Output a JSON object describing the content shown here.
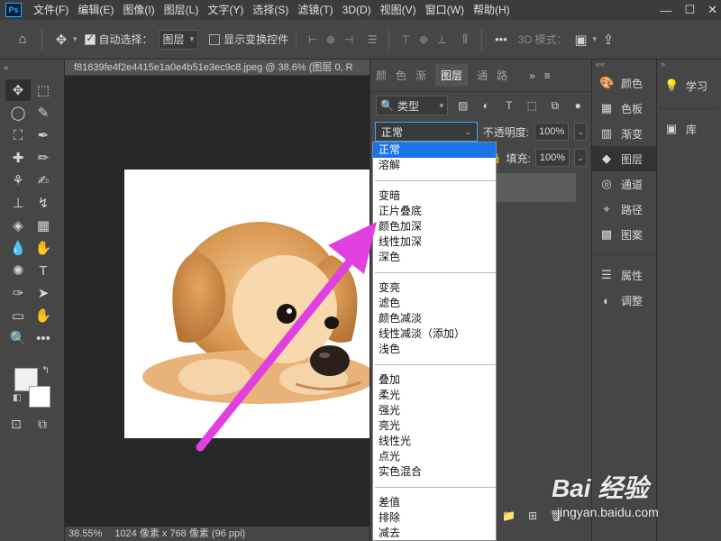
{
  "app": {
    "logo": "Ps",
    "menu": [
      "文件(F)",
      "编辑(E)",
      "图像(I)",
      "图层(L)",
      "文字(Y)",
      "选择(S)",
      "滤镜(T)",
      "3D(D)",
      "视图(V)",
      "窗口(W)",
      "帮助(H)"
    ],
    "window_controls": [
      "—",
      "☐",
      "✕"
    ]
  },
  "options_bar": {
    "auto_select_label": "自动选择：",
    "auto_select_target": "图层",
    "transform_controls_label": "显示变换控件",
    "more": "•••",
    "mode_3d_label": "3D 模式："
  },
  "toolbar": {
    "collapse": "«",
    "tools": [
      [
        "move-tool",
        "marquee-tool"
      ],
      [
        "lasso-tool",
        "quick-select-tool"
      ],
      [
        "crop-tool",
        "eyedropper-tool"
      ],
      [
        "healing-brush-tool",
        "brush-tool"
      ],
      [
        "clone-stamp-tool",
        "history-brush-tool"
      ],
      [
        "stamp-tool",
        "smudge-tool"
      ],
      [
        "eraser-tool",
        "gradient-tool"
      ],
      [
        "blur-tool",
        "dodge-tool"
      ],
      [
        "sponge-tool",
        "type-tool"
      ],
      [
        "pen-tool",
        "path-select-tool"
      ],
      [
        "shape-tool",
        "hand-tool"
      ],
      [
        "zoom-tool",
        "more-tools"
      ]
    ],
    "tool_glyphs": [
      [
        "✥",
        "⬚"
      ],
      [
        "◯",
        "✎"
      ],
      [
        "⛶",
        "✒"
      ],
      [
        "✚",
        "✏"
      ],
      [
        "⚘",
        "✍"
      ],
      [
        "⊥",
        "↯"
      ],
      [
        "◈",
        "▦"
      ],
      [
        "💧",
        "✋"
      ],
      [
        "✺",
        "T"
      ],
      [
        "✑",
        "➤"
      ],
      [
        "▭",
        "✋"
      ],
      [
        "🔍",
        "•••"
      ]
    ]
  },
  "document": {
    "tab_title": "f81639fe4f2e4415e1a0e4b51e3ec9c8.jpeg @ 38.6% (图层 0, R",
    "zoom": "38.55%",
    "dimensions": "1024 像素 x 768 像素 (96 ppi)"
  },
  "layers_panel": {
    "tabs": [
      "颜",
      "色",
      "渐",
      "图层",
      "通",
      "路"
    ],
    "expand": "»",
    "kind_label": "类型",
    "blend_mode": "正常",
    "opacity_label": "不透明度:",
    "opacity_value": "100%",
    "fill_label": "填充:",
    "fill_value": "100%"
  },
  "blend_dropdown": {
    "groups": [
      [
        "正常",
        "溶解"
      ],
      [
        "变暗",
        "正片叠底",
        "颜色加深",
        "线性加深",
        "深色"
      ],
      [
        "变亮",
        "滤色",
        "颜色减淡",
        "线性减淡（添加）",
        "浅色"
      ],
      [
        "叠加",
        "柔光",
        "强光",
        "亮光",
        "线性光",
        "点光",
        "实色混合"
      ],
      [
        "差值",
        "排除",
        "减去"
      ]
    ],
    "selected": "正常"
  },
  "right_panels": {
    "items_top": [
      {
        "icon": "palette-icon",
        "glyph": "🎨",
        "label": "颜色"
      },
      {
        "icon": "swatches-icon",
        "glyph": "▦",
        "label": "色板"
      },
      {
        "icon": "gradient-icon",
        "glyph": "▥",
        "label": "渐变"
      },
      {
        "icon": "layers-icon",
        "glyph": "◆",
        "label": "图层"
      },
      {
        "icon": "channels-icon",
        "glyph": "◎",
        "label": "通道"
      },
      {
        "icon": "paths-icon",
        "glyph": "⌖",
        "label": "路径"
      },
      {
        "icon": "patterns-icon",
        "glyph": "▩",
        "label": "图案"
      }
    ],
    "items_bottom": [
      {
        "icon": "properties-icon",
        "glyph": "☰",
        "label": "属性"
      },
      {
        "icon": "adjustments-icon",
        "glyph": "◐",
        "label": "调整"
      }
    ],
    "learn": {
      "glyph": "💡",
      "label": "学习"
    },
    "library": {
      "glyph": "▣",
      "label": "库"
    }
  },
  "watermark": {
    "brand": "Bai 经验",
    "url": "jingyan.baidu.com"
  },
  "colors": {
    "menubar": "#3c3c3c",
    "panel": "#464646",
    "canvas_bg": "#282828",
    "accent": "#31a8ff",
    "selection": "#1a73e8",
    "arrow": "#e040e0"
  }
}
